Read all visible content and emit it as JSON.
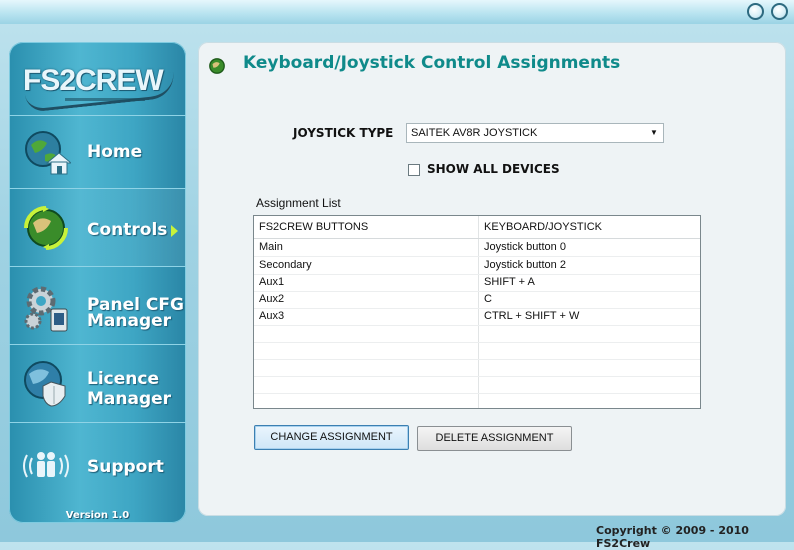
{
  "window": {
    "min_label": "",
    "close_label": ""
  },
  "sidebar": {
    "logo": "FS2CREW",
    "items": [
      {
        "label": "Home",
        "icon": "home-globe-icon"
      },
      {
        "label": "Controls",
        "icon": "controls-globe-icon",
        "active": true
      },
      {
        "label_line1": "Panel CFG",
        "label_line2": "Manager",
        "icon": "gears-icon"
      },
      {
        "label_line1": "Licence",
        "label_line2": "Manager",
        "icon": "shield-globe-icon"
      },
      {
        "label": "Support",
        "icon": "support-people-icon"
      }
    ],
    "version": "Version 1.0"
  },
  "main": {
    "title": "Keyboard/Joystick Control Assignments",
    "joystick_type_label": "JOYSTICK TYPE",
    "joystick_type_value": "SAITEK AV8R JOYSTICK",
    "show_all_devices_label": "SHOW ALL DEVICES",
    "show_all_devices_checked": false,
    "assignment_list_title": "Assignment List",
    "columns": [
      "FS2CREW BUTTONS",
      "KEYBOARD/JOYSTICK"
    ],
    "rows": [
      {
        "button": "Main",
        "assignment": "Joystick button 0"
      },
      {
        "button": "Secondary",
        "assignment": "Joystick button 2"
      },
      {
        "button": "Aux1",
        "assignment": "SHIFT + A"
      },
      {
        "button": "Aux2",
        "assignment": "C"
      },
      {
        "button": "Aux3",
        "assignment": "CTRL + SHIFT + W"
      }
    ],
    "change_assignment_label": "CHANGE ASSIGNMENT",
    "delete_assignment_label": "DELETE ASSIGNMENT"
  },
  "footer": {
    "copyright": "Copyright © 2009 - 2010 FS2Crew"
  },
  "colors": {
    "title": "#0f8a8a",
    "sidebar": "#3ea6c4",
    "accent_arrow": "#c8f23a"
  }
}
